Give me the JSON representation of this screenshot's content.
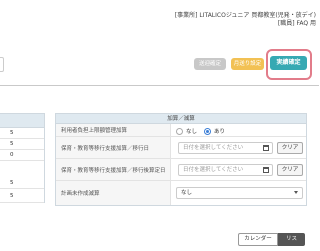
{
  "header": {
    "facility": "[事業所] LITALICOジュニア 買都教室(児発・放デイ)",
    "role": "[職員] FAQ 用"
  },
  "toolbar": {
    "grey_button": "送迎確定",
    "yellow_button": "月送り設定",
    "teal_button": "実績確定"
  },
  "left_panel": {
    "rows": [
      "5",
      "5",
      "0",
      "5",
      "5"
    ]
  },
  "addons": {
    "section_title": "加算／減算",
    "rows": [
      {
        "label": "利用者負担上限額管理加算",
        "type": "radio",
        "options": [
          "なし",
          "あり"
        ],
        "selected": "あり"
      },
      {
        "label": "保育・教育等移行支援加算／移行日",
        "type": "date",
        "placeholder": "日付を選択してください",
        "clear_label": "クリア"
      },
      {
        "label": "保育・教育等移行支援加算／移行後算定日",
        "type": "date",
        "placeholder": "日付を選択してください",
        "clear_label": "クリア"
      },
      {
        "label": "計画未作成減算",
        "type": "select",
        "value": "なし"
      }
    ]
  },
  "view_toggle": {
    "calendar": "カレンダー",
    "list": "リスト",
    "active": "リスト"
  },
  "colors": {
    "teal": "#36a9b3",
    "yellow": "#f2c154",
    "highlight": "#e27c8a",
    "header_bg": "#dfe9f0"
  }
}
